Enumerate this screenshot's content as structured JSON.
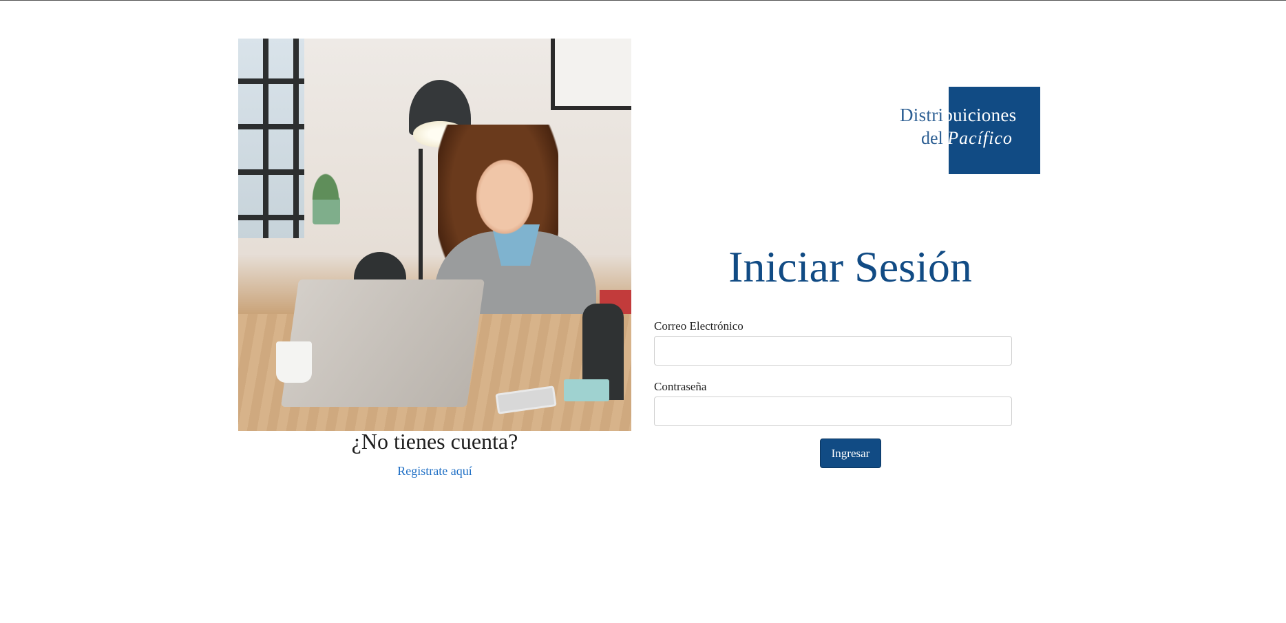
{
  "brand": {
    "logo_line1_left": "Distri",
    "logo_line1_right": "buiciones",
    "logo_line2_left": "del ",
    "logo_line2_right": "Pacífico",
    "logo_color": "#114b84"
  },
  "signup": {
    "question": "¿No tienes cuenta?",
    "link_label": "Registrate aquí"
  },
  "login": {
    "title": "Iniciar Sesión",
    "email_label": "Correo Electrónico",
    "email_value": "",
    "password_label": "Contraseña",
    "password_value": "",
    "submit_label": "Ingresar"
  },
  "theme": {
    "primary": "#114b84",
    "link": "#1f6fc5"
  }
}
